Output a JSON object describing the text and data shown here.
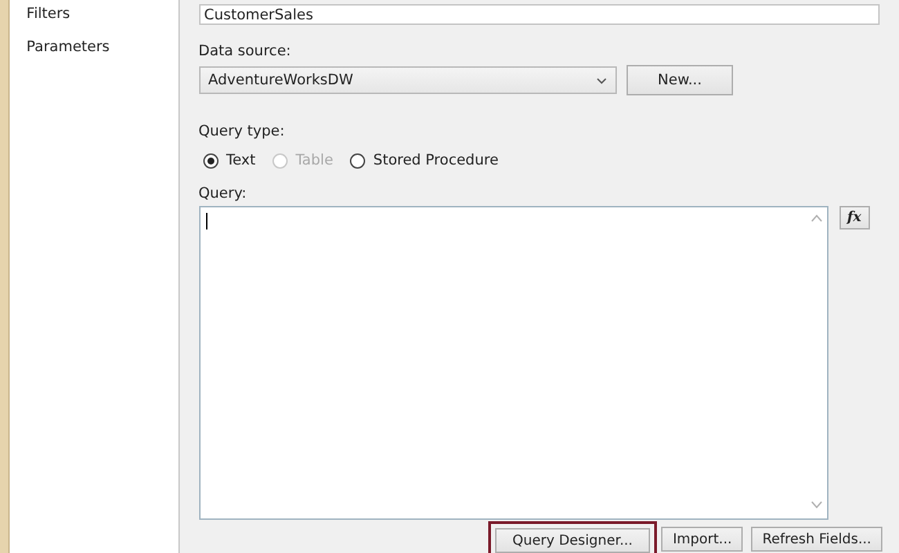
{
  "sidebar": {
    "items": [
      {
        "label": "Filters"
      },
      {
        "label": "Parameters"
      }
    ]
  },
  "name_field": {
    "value": "CustomerSales"
  },
  "data_source": {
    "label": "Data source:",
    "value": "AdventureWorksDW",
    "new_button": "New..."
  },
  "query_type": {
    "label": "Query type:",
    "options": [
      {
        "label": "Text",
        "selected": true,
        "disabled": false
      },
      {
        "label": "Table",
        "selected": false,
        "disabled": true
      },
      {
        "label": "Stored Procedure",
        "selected": false,
        "disabled": false
      }
    ]
  },
  "query": {
    "label": "Query:",
    "fx_button": "fx"
  },
  "buttons": [
    {
      "label": "Query Designer...",
      "highlighted": true
    },
    {
      "label": "Import...",
      "highlighted": false
    },
    {
      "label": "Refresh Fields...",
      "highlighted": false
    }
  ]
}
